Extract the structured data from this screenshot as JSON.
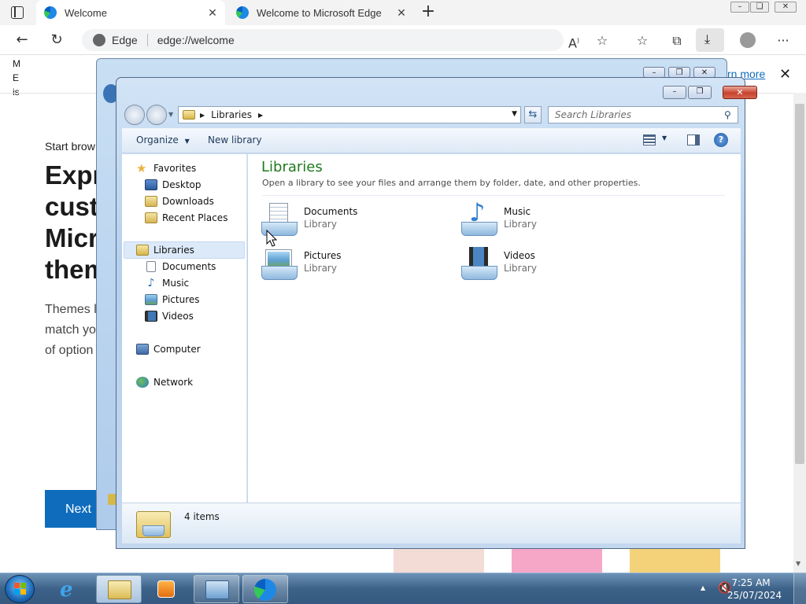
{
  "browser": {
    "tabs": [
      {
        "label": "Welcome",
        "active": true
      },
      {
        "label": "Welcome to Microsoft Edge",
        "active": false
      }
    ],
    "address": {
      "site_label": "Edge",
      "url": "edge://welcome"
    },
    "window_buttons": {
      "minimize": "–",
      "maximize": "❏",
      "close": "✕"
    }
  },
  "page": {
    "side_letters": [
      "M",
      "E",
      "is"
    ],
    "kicker": "Start brow",
    "headline_lines": [
      "Expr",
      "custo",
      "Micr",
      "them"
    ],
    "body_lines": [
      "Themes l",
      "match yo",
      "of option"
    ],
    "learn_more": "rn more",
    "close_glyph": "✕",
    "next_button": "Next"
  },
  "explorer": {
    "path": {
      "root_icon": "libraries-icon",
      "crumbs": [
        "Libraries"
      ]
    },
    "search_placeholder": "Search Libraries",
    "commands": {
      "organize": "Organize",
      "new_library": "New library"
    },
    "nav": {
      "favorites": {
        "label": "Favorites",
        "items": [
          "Desktop",
          "Downloads",
          "Recent Places"
        ]
      },
      "libraries": {
        "label": "Libraries",
        "items": [
          "Documents",
          "Music",
          "Pictures",
          "Videos"
        ]
      },
      "computer": "Computer",
      "network": "Network"
    },
    "content": {
      "title": "Libraries",
      "subtitle": "Open a library to see your files and arrange them by folder, date, and other properties.",
      "libraries": [
        {
          "name": "Documents",
          "type": "Library",
          "icon": "documents-library-icon"
        },
        {
          "name": "Music",
          "type": "Library",
          "icon": "music-library-icon"
        },
        {
          "name": "Pictures",
          "type": "Library",
          "icon": "pictures-library-icon"
        },
        {
          "name": "Videos",
          "type": "Library",
          "icon": "videos-library-icon"
        }
      ]
    },
    "details": {
      "count": "4 items"
    },
    "colors": {
      "title_green": "#1e7a1e",
      "selection": "#dce9f8"
    }
  },
  "taskbar": {
    "clock_time": "7:25 AM",
    "clock_date": "25/07/2024",
    "apps": [
      "internet-explorer-icon",
      "windows-explorer-icon",
      "media-player-icon",
      "control-panel-icon",
      "edge-icon"
    ]
  }
}
